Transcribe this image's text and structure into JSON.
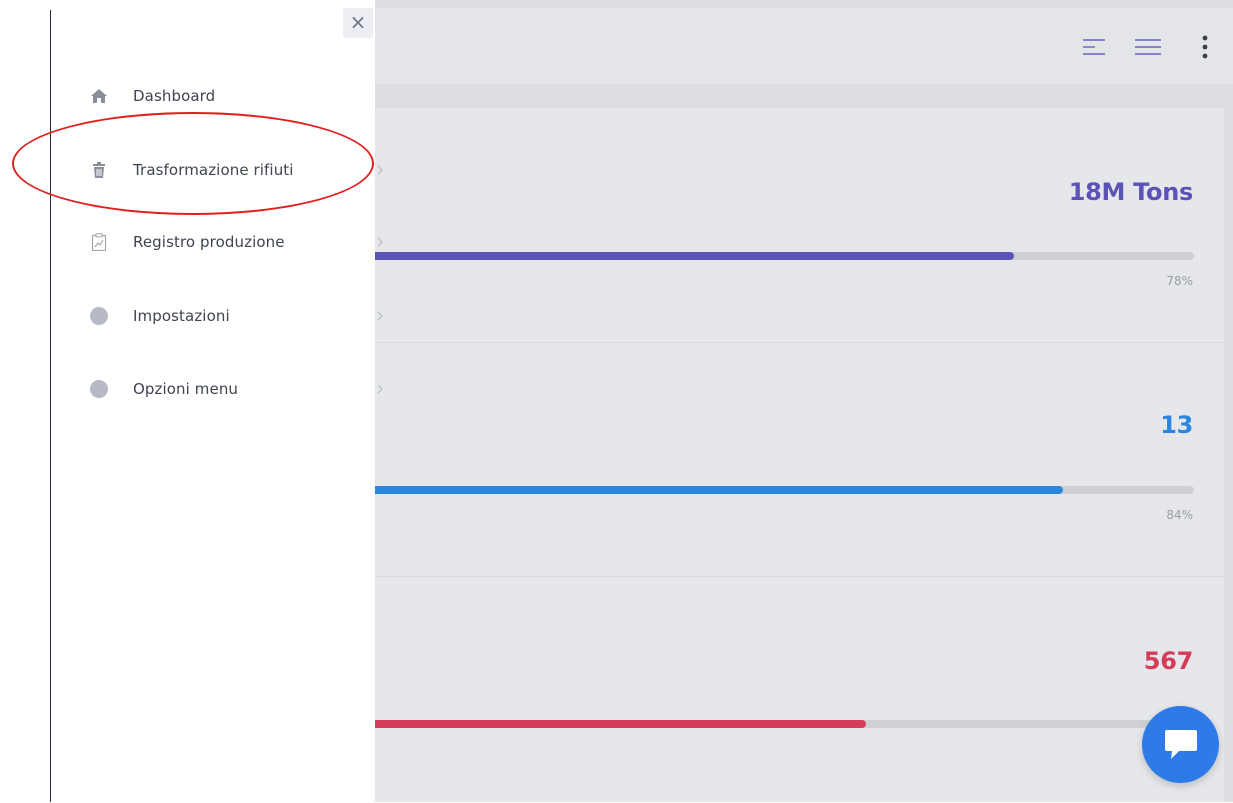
{
  "sidebar": {
    "close_label": "×",
    "items": [
      {
        "label": "Dashboard",
        "icon": "home-icon",
        "has_chevron": false
      },
      {
        "label": "Trasformazione rifiuti",
        "icon": "trash-icon",
        "has_chevron": true
      },
      {
        "label": "Registro produzione",
        "icon": "clipboard-chart-icon",
        "has_chevron": true
      },
      {
        "label": "Impostazioni",
        "icon": "dot-icon",
        "has_chevron": true
      },
      {
        "label": "Opzioni menu",
        "icon": "dot-icon",
        "has_chevron": true
      }
    ]
  },
  "header": {
    "icons": [
      "align-left-icon",
      "hamburger-icon",
      "kebab-menu-icon"
    ]
  },
  "metrics": [
    {
      "value": "18M Tons",
      "percent_label": "78%",
      "progress": 0.78,
      "color": "#5b54b6"
    },
    {
      "value": "13",
      "percent_label": "84%",
      "progress": 0.84,
      "color": "#2a86de"
    },
    {
      "value": "567",
      "percent_label": "",
      "progress": 0.6,
      "color": "#d63b58"
    }
  ],
  "colors": {
    "accent_purple": "#5b54b6",
    "accent_blue": "#2a86de",
    "accent_red": "#d63b58",
    "chat_button": "#2e7be8",
    "highlight_circle": "#e0201e"
  }
}
